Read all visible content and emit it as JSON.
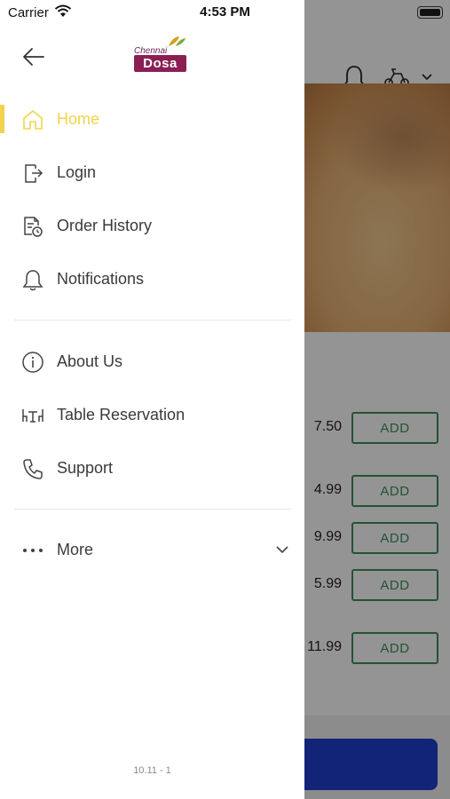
{
  "status_bar": {
    "carrier": "Carrier",
    "time": "4:53 PM"
  },
  "drawer": {
    "logo_top": "Chennai",
    "logo_main": "Dosa",
    "menu": [
      {
        "label": "Home",
        "icon": "home-icon",
        "active": true
      },
      {
        "label": "Login",
        "icon": "login-icon"
      },
      {
        "label": "Order History",
        "icon": "order-history-icon"
      },
      {
        "label": "Notifications",
        "icon": "bell-icon"
      },
      {
        "label": "About Us",
        "icon": "info-icon"
      },
      {
        "label": "Table Reservation",
        "icon": "table-icon"
      },
      {
        "label": "Support",
        "icon": "phone-icon"
      },
      {
        "label": "More",
        "icon": "more-dots-icon"
      }
    ],
    "version": "10.11 - 1",
    "accent_color": "#f2d34b"
  },
  "background": {
    "items": [
      {
        "price": "7.50",
        "add_label": "ADD"
      },
      {
        "price": "4.99",
        "add_label": "ADD"
      },
      {
        "price": "9.99",
        "add_label": "ADD"
      },
      {
        "price": "5.99",
        "add_label": "ADD"
      },
      {
        "price": "11.99",
        "add_label": "ADD"
      }
    ],
    "add_color": "#3f8f5c",
    "cta_color": "#1f3fcf"
  }
}
